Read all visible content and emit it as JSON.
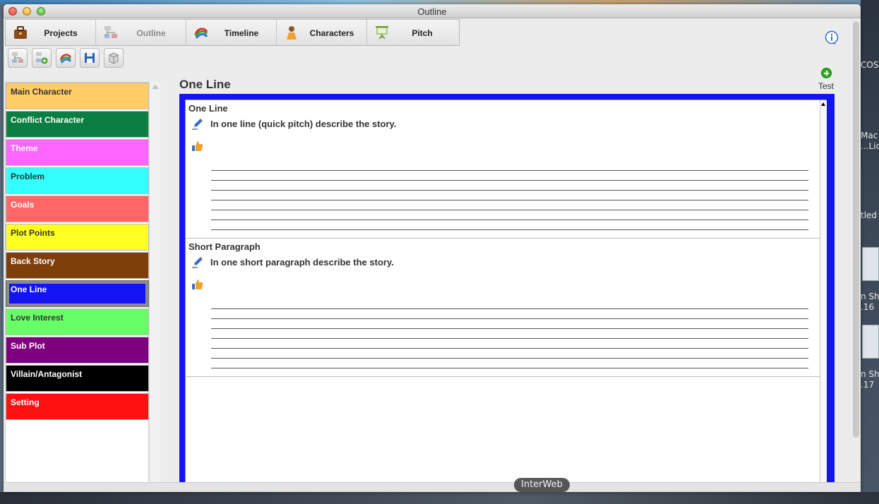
{
  "window": {
    "title": "Outline"
  },
  "tabs": [
    {
      "label": "Projects",
      "icon": "briefcase-icon"
    },
    {
      "label": "Outline",
      "icon": "outline-chart-icon",
      "active": true
    },
    {
      "label": "Timeline",
      "icon": "timeline-swirl-icon"
    },
    {
      "label": "Characters",
      "icon": "character-figure-icon"
    },
    {
      "label": "Pitch",
      "icon": "presentation-easel-icon"
    }
  ],
  "toolbar": {
    "buttons": [
      "outline-chart-icon",
      "add-outline-icon",
      "timeline-swirl-icon",
      "save-disk-icon",
      "print-box-icon"
    ]
  },
  "sidebar": {
    "items": [
      {
        "label": "Main Character",
        "bg": "#FFCC66",
        "fg": "#333333"
      },
      {
        "label": "Conflict Character",
        "bg": "#0B7F41",
        "fg": "#FFFFFF"
      },
      {
        "label": "Theme",
        "bg": "#FF66FF",
        "fg": "#FFFFFF"
      },
      {
        "label": "Problem",
        "bg": "#33FFFF",
        "fg": "#333333"
      },
      {
        "label": "Goals",
        "bg": "#FF6666",
        "fg": "#FFFFFF"
      },
      {
        "label": "Plot Points",
        "bg": "#FFFF22",
        "fg": "#333333"
      },
      {
        "label": "Back Story",
        "bg": "#7F3F0B",
        "fg": "#FFFFFF"
      },
      {
        "label": "One Line",
        "bg": "#1414F2",
        "fg": "#FFFFFF",
        "selected": true
      },
      {
        "label": "Love Interest",
        "bg": "#66FF66",
        "fg": "#333333"
      },
      {
        "label": "Sub Plot",
        "bg": "#7F007F",
        "fg": "#FFFFFF"
      },
      {
        "label": "Villain/Antagonist",
        "bg": "#000000",
        "fg": "#FFFFFF"
      },
      {
        "label": "Setting",
        "bg": "#FF1111",
        "fg": "#FFFFFF"
      }
    ]
  },
  "main": {
    "section_title": "One Line",
    "add_button_label": "Test",
    "accent_color": "#1414F2",
    "questions": [
      {
        "heading": "One Line",
        "prompt": "In one line (quick pitch) describe the story."
      },
      {
        "heading": "Short Paragraph",
        "prompt": "In one short paragraph describe the story."
      }
    ]
  },
  "desktop": {
    "dock_label": "InterWeb",
    "right_edge_texts": [
      "COS",
      "Mac",
      "...Lic",
      "tled",
      "n Sh",
      ".16",
      "n Sh",
      ".17"
    ]
  }
}
